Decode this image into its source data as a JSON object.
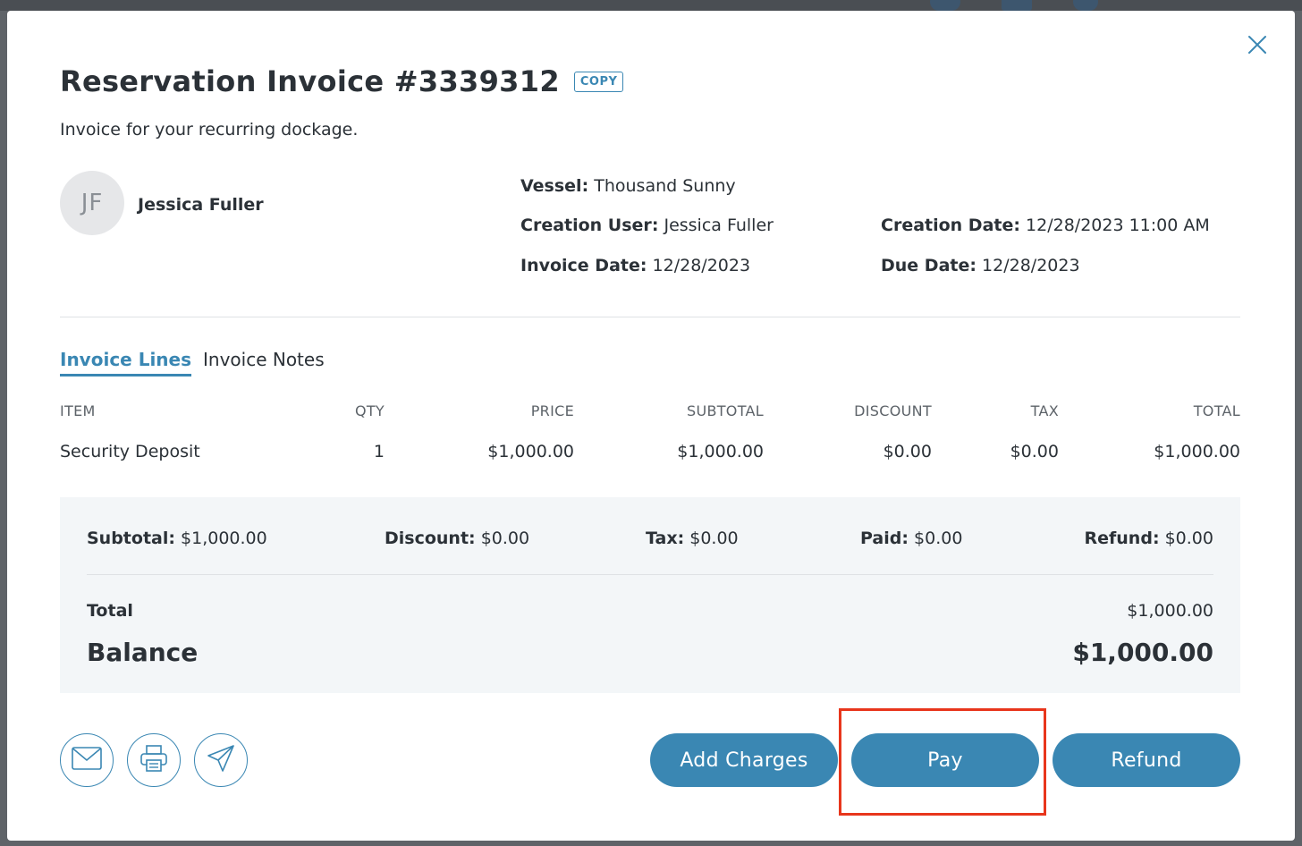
{
  "modal": {
    "title": "Reservation Invoice #3339312",
    "copy_label": "COPY",
    "subtitle": "Invoice for your recurring dockage."
  },
  "customer": {
    "initials": "JF",
    "name": "Jessica Fuller"
  },
  "details": {
    "vessel_label": "Vessel",
    "vessel_value": "Thousand Sunny",
    "creation_user_label": "Creation User",
    "creation_user_value": "Jessica Fuller",
    "creation_date_label": "Creation Date",
    "creation_date_value": "12/28/2023 11:00 AM",
    "invoice_date_label": "Invoice Date",
    "invoice_date_value": "12/28/2023",
    "due_date_label": "Due Date",
    "due_date_value": "12/28/2023"
  },
  "tabs": [
    {
      "label": "Invoice Lines",
      "active": true
    },
    {
      "label": "Invoice Notes",
      "active": false
    }
  ],
  "table": {
    "headers": [
      "ITEM",
      "QTY",
      "PRICE",
      "SUBTOTAL",
      "DISCOUNT",
      "TAX",
      "TOTAL"
    ],
    "rows": [
      [
        "Security Deposit",
        "1",
        "$1,000.00",
        "$1,000.00",
        "$0.00",
        "$0.00",
        "$1,000.00"
      ]
    ]
  },
  "summary": {
    "subtotal_label": "Subtotal",
    "subtotal_value": "$1,000.00",
    "discount_label": "Discount",
    "discount_value": "$0.00",
    "tax_label": "Tax",
    "tax_value": "$0.00",
    "paid_label": "Paid",
    "paid_value": "$0.00",
    "refund_label": "Refund",
    "refund_value": "$0.00",
    "total_label": "Total",
    "total_value": "$1,000.00",
    "balance_label": "Balance",
    "balance_value": "$1,000.00"
  },
  "actions": {
    "icons": [
      "mail-icon",
      "printer-icon",
      "send-icon"
    ],
    "add_charges_label": "Add Charges",
    "pay_label": "Pay",
    "refund_label": "Refund"
  },
  "colors": {
    "accent": "#3a87b3",
    "highlight": "#e8361c"
  }
}
